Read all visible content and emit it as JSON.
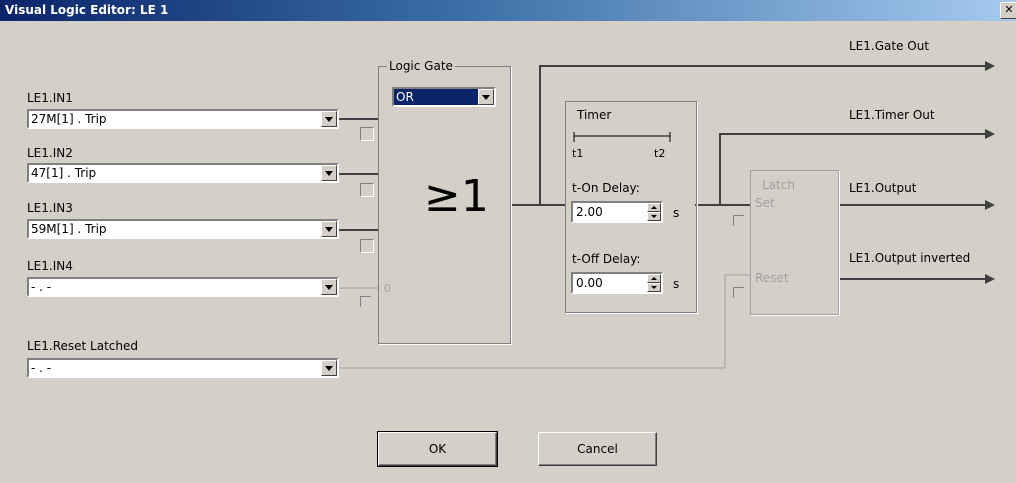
{
  "window": {
    "title": "Visual Logic Editor: LE 1",
    "close_glyph": "✕"
  },
  "inputs": [
    {
      "label": "LE1.IN1",
      "value": "27M[1] . Trip"
    },
    {
      "label": "LE1.IN2",
      "value": "47[1] . Trip"
    },
    {
      "label": "LE1.IN3",
      "value": "59M[1] . Trip"
    },
    {
      "label": "LE1.IN4",
      "value": "- . -"
    }
  ],
  "reset_latched": {
    "label": "LE1.Reset Latched",
    "value": "- . -"
  },
  "logic_gate": {
    "title": "Logic Gate",
    "selected": "OR",
    "symbol": "≥1",
    "unconnected_marker": "0"
  },
  "timer": {
    "title": "Timer",
    "t1": "t1",
    "t2": "t2",
    "on_delay_label": "t-On Delay:",
    "on_delay_value": "2.00",
    "on_delay_unit": "s",
    "off_delay_label": "t-Off Delay:",
    "off_delay_value": "0.00",
    "off_delay_unit": "s"
  },
  "latch": {
    "title": "Latch",
    "set": "Set",
    "reset": "Reset"
  },
  "outputs": {
    "gate_out": "LE1.Gate Out",
    "timer_out": "LE1.Timer Out",
    "output": "LE1.Output",
    "output_inverted": "LE1.Output inverted"
  },
  "buttons": {
    "ok": "OK",
    "cancel": "Cancel"
  }
}
